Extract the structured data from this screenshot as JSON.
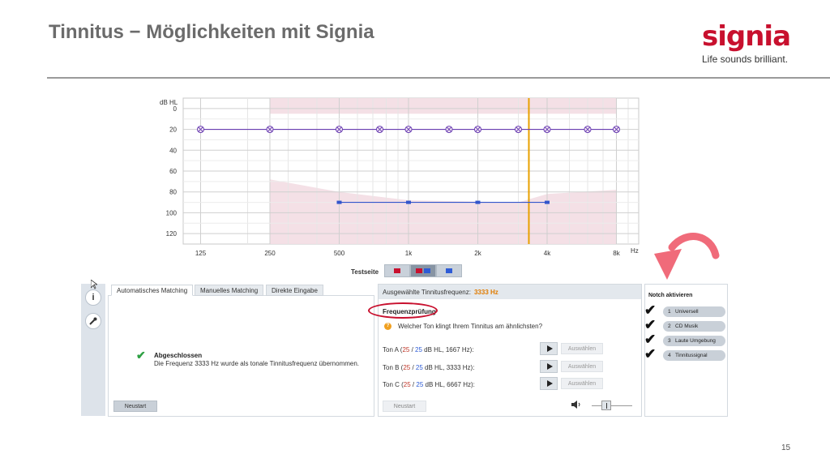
{
  "slide": {
    "title": "Tinnitus − Möglichkeiten mit Signia",
    "logo_text": "signia",
    "tagline": "Life sounds brilliant.",
    "page_number": "15"
  },
  "chart_data": {
    "type": "line",
    "ylabel": "dB HL",
    "y_ticks": [
      "0",
      "20",
      "40",
      "60",
      "80",
      "100",
      "120"
    ],
    "ylim": [
      -10,
      130
    ],
    "y_inverted": true,
    "x_ticks": [
      "125",
      "250",
      "500",
      "1k",
      "2k",
      "4k",
      "8k"
    ],
    "x_tick_values": [
      125,
      250,
      500,
      1000,
      2000,
      4000,
      8000
    ],
    "x_scale": "log",
    "x_unit": "Hz",
    "xlim": [
      105,
      10000
    ],
    "grid": true,
    "series": [
      {
        "x": [
          125,
          250,
          500,
          750,
          1000,
          1500,
          2000,
          3000,
          4000,
          6000,
          8000
        ],
        "y": [
          20,
          20,
          20,
          20,
          20,
          20,
          20,
          20,
          20,
          20,
          20
        ],
        "marker": "x-circle",
        "color": "#6a3fb3"
      },
      {
        "x": [
          500,
          1000,
          2000,
          4000
        ],
        "y": [
          90,
          90,
          90,
          90
        ],
        "marker": "square",
        "color": "#3355cc"
      }
    ],
    "tinnitus_frequency_line": {
      "x": 3333,
      "color": "#e8a000"
    },
    "shaded_band": {
      "x_range": [
        250,
        8000
      ],
      "color": "#f3dde3"
    }
  },
  "testseite": {
    "label": "Testseite"
  },
  "left_panel": {
    "tabs": [
      "Automatisches Matching",
      "Manuelles Matching",
      "Direkte Eingabe"
    ],
    "status_title": "Abgeschlossen",
    "status_text": "Die Frequenz 3333 Hz wurde als tonale Tinnitusfrequenz übernommen.",
    "button_label": "Neustart",
    "info_icon_glyph": "i"
  },
  "mid_panel": {
    "header_label": "Ausgewählte Tinnitusfrequenz:",
    "header_freq": "3333 Hz",
    "section_label": "Frequenzprüfung",
    "question": "Welcher Ton klingt Ihrem Tinnitus am ähnlichsten?",
    "tones": [
      {
        "name": "Ton A (",
        "red": "25",
        "sep": " / ",
        "blue": "25",
        "rest": " dB HL, 1667 Hz):",
        "button": "Auswählen"
      },
      {
        "name": "Ton B (",
        "red": "25",
        "sep": " / ",
        "blue": "25",
        "rest": " dB HL, 3333 Hz):",
        "button": "Auswählen"
      },
      {
        "name": "Ton C (",
        "red": "25",
        "sep": " / ",
        "blue": "25",
        "rest": " dB HL, 6667 Hz):",
        "button": "Auswählen"
      }
    ],
    "restart_label": "Neustart"
  },
  "right_panel": {
    "title": "Notch aktivieren",
    "items": [
      {
        "num": "1",
        "label": "Universell"
      },
      {
        "num": "2",
        "label": "CD Musik"
      },
      {
        "num": "3",
        "label": "Laute Umgebung"
      },
      {
        "num": "4",
        "label": "Tinnitussignal"
      }
    ]
  },
  "colors": {
    "brand": "#c8102e",
    "accent": "#f06b7a",
    "freq_highlight": "#e07b00"
  }
}
